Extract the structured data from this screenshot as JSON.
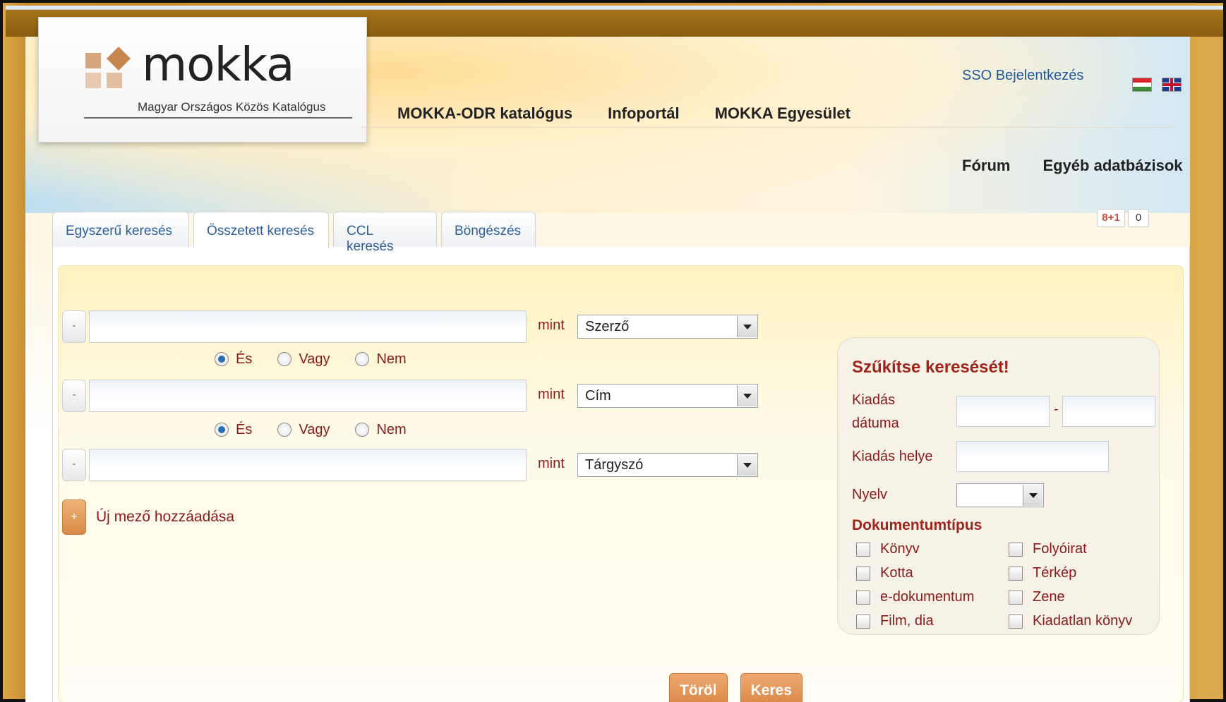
{
  "header": {
    "logo_word": "mokka",
    "logo_subtitle": "Magyar Országos Közös Katalógus",
    "nav": [
      "MOKKA-ODR katalógus",
      "Infoportál",
      "MOKKA Egyesület"
    ],
    "subnav": [
      "Fórum",
      "Egyéb adatbázisok"
    ],
    "sso_link": "SSO Bejelentkezés",
    "flags": [
      "hungarian-flag-icon",
      "uk-flag-icon"
    ]
  },
  "tabs": [
    {
      "label": "Egyszerű keresés",
      "active": false
    },
    {
      "label": "Összetett keresés",
      "active": true
    },
    {
      "label": "CCL keresés",
      "active": false
    },
    {
      "label": "Böngészés",
      "active": false
    }
  ],
  "social": {
    "gplus_label": "8+1",
    "count": "0"
  },
  "search": {
    "remove_label": "-",
    "mint_label": "mint",
    "fields": [
      {
        "value": "",
        "field": "Szerző"
      },
      {
        "value": "",
        "field": "Cím"
      },
      {
        "value": "",
        "field": "Tárgyszó"
      }
    ],
    "bool_options": [
      "És",
      "Vagy",
      "Nem"
    ],
    "bool_selected": [
      "És",
      "És"
    ],
    "add_button": "+",
    "add_label": "Új mező hozzáadása"
  },
  "filter": {
    "title": "Szűkítse keresését!",
    "date_label_1": "Kiadás",
    "date_label_2": "dátuma",
    "date_sep": "-",
    "place_label": "Kiadás helye",
    "lang_label": "Nyelv",
    "lang_value": "",
    "doc_type_title": "Dokumentumtípus",
    "doc_types": [
      "Könyv",
      "Folyóirat",
      "Kotta",
      "Térkép",
      "e-dokumentum",
      "Zene",
      "Film, dia",
      "Kiadatlan könyv"
    ]
  },
  "buttons": {
    "clear": "Töröl",
    "search": "Keres"
  },
  "colors": {
    "accent": "#d98544",
    "label_red": "#8b1a1a",
    "link_blue": "#1e58a0"
  }
}
